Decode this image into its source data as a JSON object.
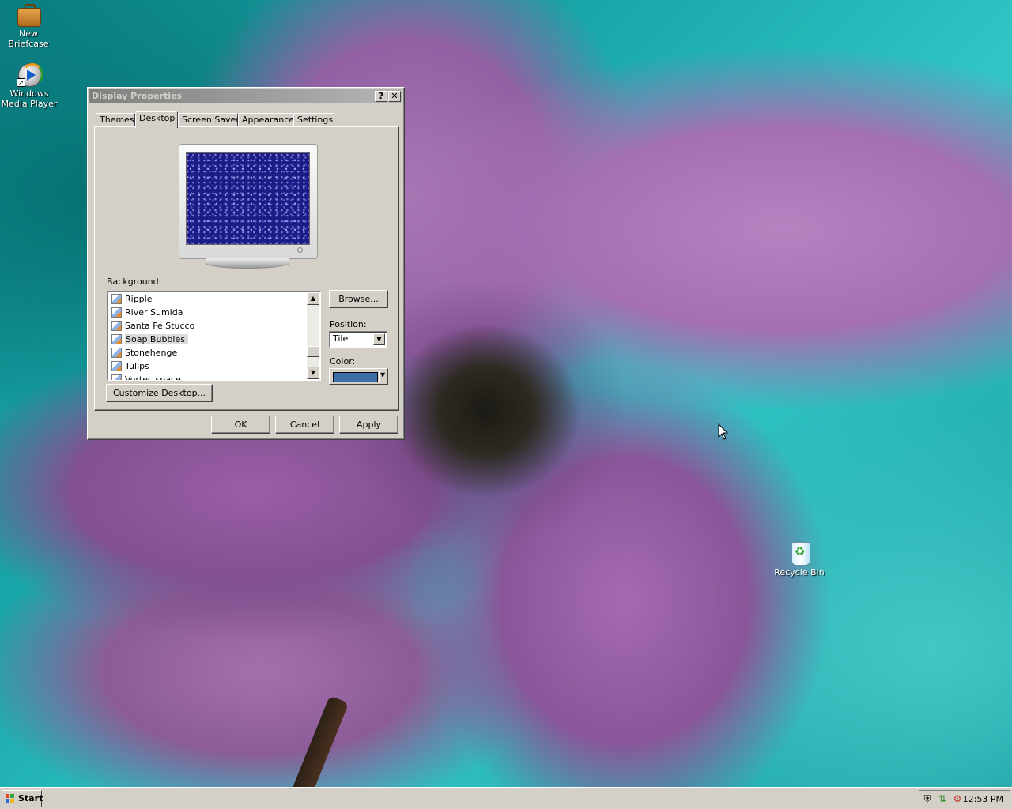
{
  "desktop": {
    "icons": [
      {
        "label": "New Briefcase",
        "icon": "briefcase-icon"
      },
      {
        "label": "Windows Media Player",
        "icon": "media-player-icon"
      },
      {
        "label": "Recycle Bin",
        "icon": "recycle-bin-icon"
      }
    ]
  },
  "dialog": {
    "title": "Display Properties",
    "help_glyph": "?",
    "close_glyph": "✕",
    "tabs": [
      "Themes",
      "Desktop",
      "Screen Saver",
      "Appearance",
      "Settings"
    ],
    "active_tab": "Desktop",
    "background_label": "Background:",
    "background_items": [
      {
        "label": "Ripple",
        "selected": false
      },
      {
        "label": "River Sumida",
        "selected": false
      },
      {
        "label": "Santa Fe Stucco",
        "selected": false
      },
      {
        "label": "Soap Bubbles",
        "selected": true
      },
      {
        "label": "Stonehenge",
        "selected": false
      },
      {
        "label": "Tulips",
        "selected": false
      },
      {
        "label": "Vortec space",
        "selected": false
      }
    ],
    "browse_label": "Browse...",
    "position_label": "Position:",
    "position_value": "Tile",
    "color_label": "Color:",
    "color_value": "#3a6ea5",
    "customize_label": "Customize Desktop...",
    "ok_label": "OK",
    "cancel_label": "Cancel",
    "apply_label": "Apply"
  },
  "taskbar": {
    "start_label": "Start",
    "tray_icons": [
      "shield-icon",
      "network-icon",
      "network-activity-icon"
    ],
    "clock": "12:53 PM"
  }
}
